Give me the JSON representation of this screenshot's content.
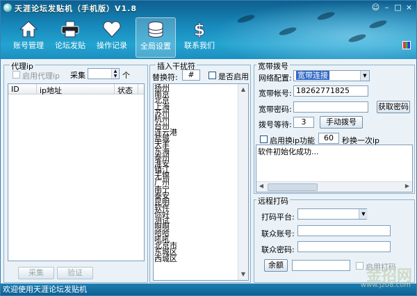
{
  "window": {
    "title": "天涯论坛发贴机（手机版）V1.8"
  },
  "toolbar": {
    "items": [
      {
        "label": "账号管理",
        "icon": "home-icon"
      },
      {
        "label": "论坛发贴",
        "icon": "printer-icon"
      },
      {
        "label": "操作记录",
        "icon": "heart-icon"
      },
      {
        "label": "全局设置",
        "icon": "database-icon",
        "selected": true
      },
      {
        "label": "联系我们",
        "icon": "dollar-icon"
      }
    ]
  },
  "proxy": {
    "title": "代理ip",
    "enable_label": "启用代理ip",
    "collect_label": "采集",
    "count_unit": "个",
    "columns": [
      "ID",
      "ip地址",
      "状态"
    ],
    "collect_button": "采集",
    "verify_button": "验证"
  },
  "insert": {
    "title": "插入干扰符",
    "replace_label": "替换符:",
    "replace_value": "#",
    "enable_label": "是否启用",
    "items": [
      "扬州",
      "南京",
      "北京",
      "上海",
      "苏州",
      "杭州",
      "台州",
      "连云港",
      "盐城",
      "大丰",
      "东海",
      "泰州",
      "淮安",
      "镇江",
      "无锡",
      "广州",
      "南宁",
      "泰安",
      "昆明",
      "软件",
      "你好",
      "测试",
      "啊啊",
      "哈哈",
      "吼吼",
      "北京市",
      "东城区",
      "西城区"
    ]
  },
  "broadband": {
    "title": "宽带拨号",
    "network_label": "网络配置:",
    "network_value": "宽带连接",
    "account_label": "宽带帐号:",
    "account_value": "18262771825",
    "password_label": "宽带密码:",
    "password_value": "",
    "get_password_button": "获取密码",
    "wait_label": "拨号等待:",
    "wait_value": "3",
    "manual_dial_button": "手动拨号",
    "enable_switch_label": "启用换ip功能",
    "switch_seconds": "60",
    "switch_suffix": "秒换一次ip",
    "log_text": "软件初始化成功..."
  },
  "captcha": {
    "title": "远程打码",
    "platform_label": "打码平台:",
    "platform_value": "",
    "account_label": "联众账号:",
    "account_value": "",
    "password_label": "联众密码:",
    "password_value": "",
    "balance_button": "余额",
    "balance_value": "",
    "enable_label": "启用打码"
  },
  "status": {
    "text": "欢迎使用天涯论坛发贴机"
  },
  "watermark": {
    "main": "金招网",
    "url": "www.jz08.com"
  }
}
